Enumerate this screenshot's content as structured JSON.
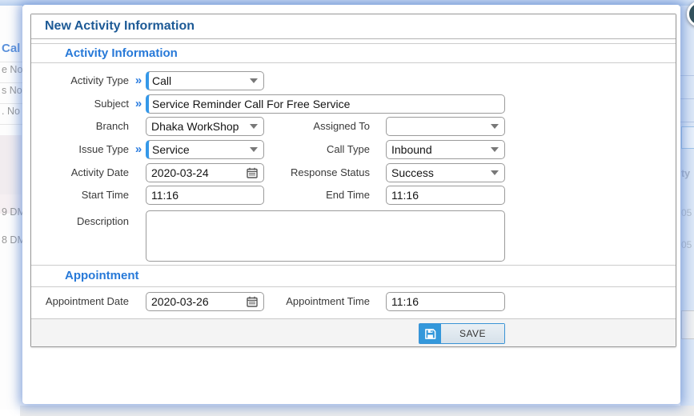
{
  "dialog": {
    "title": "New Activity Information",
    "required_marker": "»",
    "sections": {
      "activity": "Activity Information",
      "appointment": "Appointment"
    },
    "fields": {
      "activity_type": {
        "label": "Activity Type",
        "value": "Call",
        "required": true
      },
      "subject": {
        "label": "Subject",
        "value": "Service Reminder Call For Free Service",
        "required": true
      },
      "branch": {
        "label": "Branch",
        "value": "Dhaka WorkShop"
      },
      "assigned_to": {
        "label": "Assigned To",
        "value": ""
      },
      "issue_type": {
        "label": "Issue Type",
        "value": "Service",
        "required": true
      },
      "call_type": {
        "label": "Call Type",
        "value": "Inbound"
      },
      "activity_date": {
        "label": "Activity Date",
        "value": "2020-03-24"
      },
      "response_status": {
        "label": "Response Status",
        "value": "Success"
      },
      "start_time": {
        "label": "Start Time",
        "value": "11:16"
      },
      "end_time": {
        "label": "End Time",
        "value": "11:16"
      },
      "description": {
        "label": "Description",
        "value": "",
        "placeholder": ""
      },
      "appointment_date": {
        "label": "Appointment Date",
        "value": "2020-03-26"
      },
      "appointment_time": {
        "label": "Appointment Time",
        "value": "11:16"
      }
    },
    "save_label": "SAVE"
  },
  "background": {
    "left_fragments": {
      "header": "Cal",
      "row1": "e No",
      "row2": "s No",
      "row3": ". No",
      "row4": "9 DM",
      "row5": "8 DM"
    },
    "right_fragments": {
      "col": "ty",
      "num1": "05",
      "num2": "05"
    }
  },
  "colors": {
    "title_blue": "#1d5a96",
    "section_blue": "#2779d8",
    "required_blue": "#3598e8",
    "save_blue": "#3498db",
    "close_slate": "#32515d",
    "footer_gray": "#f4f4f4"
  }
}
